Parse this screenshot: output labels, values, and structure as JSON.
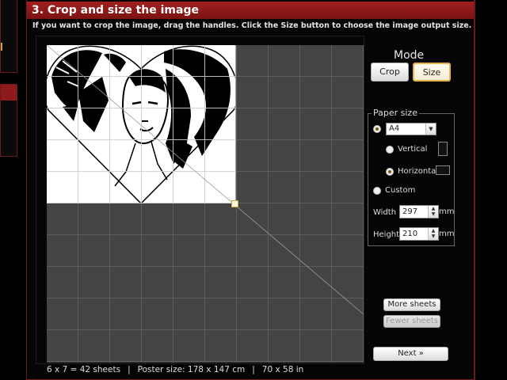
{
  "section": {
    "title": "3. Crop and size the image",
    "instruction": "If you want to crop the image, drag the handles. Click the Size button to choose the image output size."
  },
  "mode": {
    "title": "Mode",
    "crop_label": "Crop",
    "size_label": "Size",
    "active": "Size"
  },
  "paper_size": {
    "legend": "Paper size",
    "selected": "A4",
    "preset_selected": true,
    "vertical_label": "Vertical",
    "horizontal_label": "Horizontal",
    "orientation": "Horizontal",
    "custom_label": "Custom",
    "width_label": "Width",
    "width_value": "297",
    "width_unit": "mm",
    "height_label": "Height",
    "height_value": "210",
    "height_unit": "mm"
  },
  "sheets": {
    "more_label": "More sheets",
    "fewer_label": "Fewer sheets",
    "next_label": "Next »"
  },
  "status": {
    "sheets": "6 x 7 = 42 sheets",
    "poster": "Poster size: 178 x 147 cm",
    "inches": "70 x 58 in",
    "separator": "|"
  },
  "colors": {
    "header_red": "#8d1b1b",
    "accent_gold": "#e3b44a",
    "grid_dark": "#444444"
  }
}
